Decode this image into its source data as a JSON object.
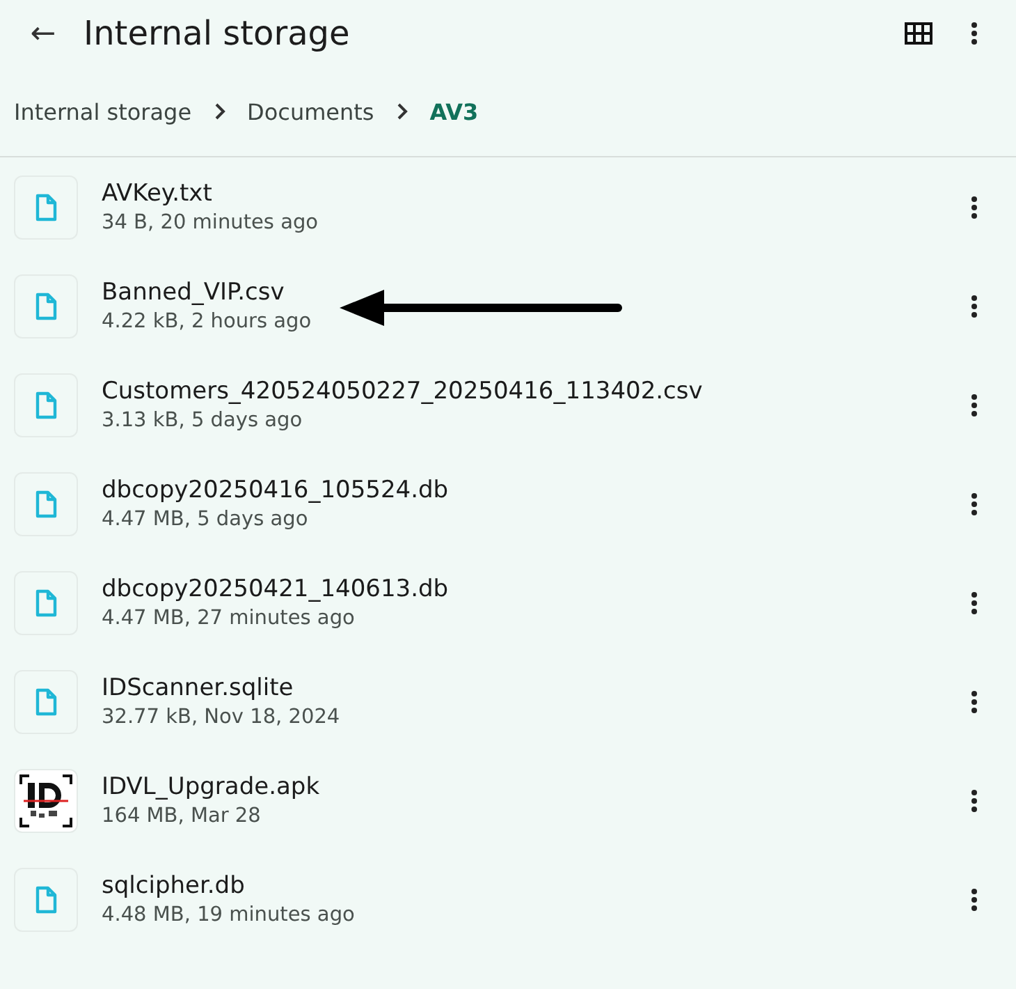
{
  "app_bar": {
    "back": "←",
    "title": "Internal storage"
  },
  "breadcrumb": [
    {
      "label": "Internal storage",
      "selected": false
    },
    {
      "label": "Documents",
      "selected": false
    },
    {
      "label": "AV3",
      "selected": true
    }
  ],
  "files": [
    {
      "kind": "file",
      "name": "AVKey.txt",
      "details": "34 B, 20 minutes ago",
      "pointed": false
    },
    {
      "kind": "file",
      "name": "Banned_VIP.csv",
      "details": "4.22 kB, 2 hours ago",
      "pointed": true
    },
    {
      "kind": "file",
      "name": "Customers_420524050227_20250416_113402.csv",
      "details": "3.13 kB, 5 days ago",
      "pointed": false
    },
    {
      "kind": "file",
      "name": "dbcopy20250416_105524.db",
      "details": "4.47 MB, 5 days ago",
      "pointed": false
    },
    {
      "kind": "file",
      "name": "dbcopy20250421_140613.db",
      "details": "4.47 MB, 27 minutes ago",
      "pointed": false
    },
    {
      "kind": "file",
      "name": "IDScanner.sqlite",
      "details": "32.77 kB, Nov 18, 2024",
      "pointed": false
    },
    {
      "kind": "app",
      "name": "IDVL_Upgrade.apk",
      "details": "164 MB, Mar 28",
      "pointed": false
    },
    {
      "kind": "file",
      "name": "sqlcipher.db",
      "details": "4.48 MB, 19 minutes ago",
      "pointed": false
    }
  ]
}
